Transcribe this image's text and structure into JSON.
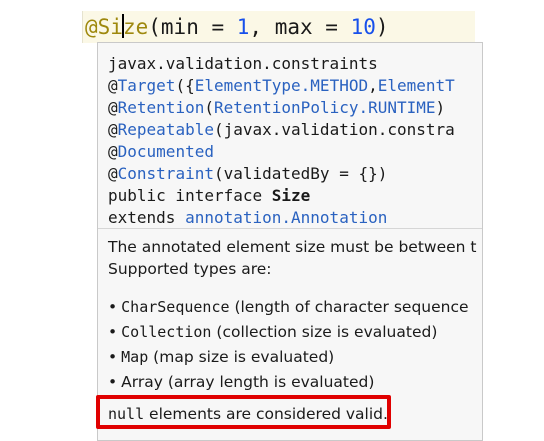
{
  "editor": {
    "at": "@",
    "annotation_part1": "Si",
    "annotation_part2": "ze",
    "paren_open": "(",
    "arg1_name": "min = ",
    "arg1_value": "1",
    "comma": ", ",
    "arg2_name": "max = ",
    "arg2_value": "10",
    "paren_close": ")"
  },
  "declaration": {
    "package": "javax.validation.constraints",
    "target_at": "@",
    "target_name": "Target",
    "target_args": "({",
    "target_v1": "ElementType.METHOD",
    "target_comma": ",",
    "target_v2": "ElementT",
    "retention_at": "@",
    "retention_name": "Retention",
    "retention_open": "(",
    "retention_value": "RetentionPolicy.RUNTIME",
    "retention_close": ")",
    "repeatable_at": "@",
    "repeatable_name": "Repeatable",
    "repeatable_args": "(javax.validation.constra",
    "documented_at": "@",
    "documented_name": "Documented",
    "constraint_at": "@",
    "constraint_name": "Constraint",
    "constraint_args": "(validatedBy = {})",
    "interface_prefix": "public interface ",
    "interface_name": "Size",
    "extends_keyword": "extends ",
    "extends_type": "annotation.Annotation"
  },
  "doc": {
    "description_line1": "The annotated element size must be between t",
    "description_line2": "Supported types are:",
    "types": [
      {
        "code": "CharSequence",
        "text": " (length of character sequence"
      },
      {
        "code": "Collection",
        "text": " (collection size is evaluated)"
      },
      {
        "code": "Map",
        "text": " (map size is evaluated)"
      },
      {
        "code": "",
        "text": "Array (array length is evaluated)"
      }
    ],
    "null_code": "null",
    "null_text": " elements are considered valid."
  },
  "colors": {
    "annotation": "#9e880d",
    "number": "#1750eb",
    "link": "#2a62c0",
    "highlight": "#e00000"
  }
}
